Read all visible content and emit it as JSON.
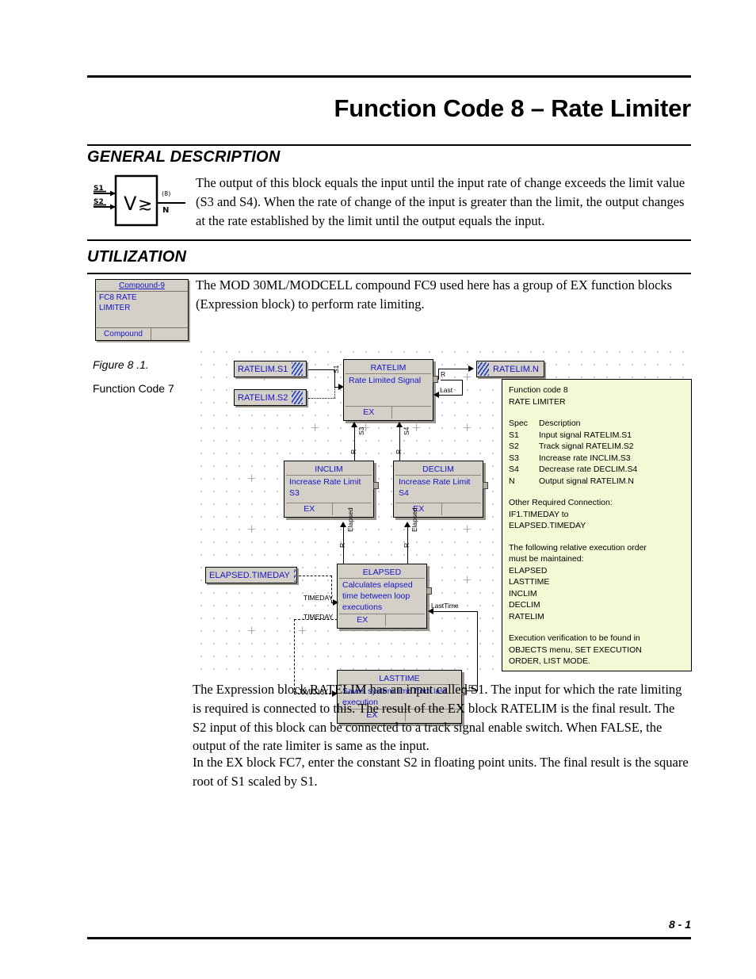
{
  "document": {
    "title": "Function Code 8 – Rate Limiter",
    "footer_page": "8 - 1"
  },
  "general_description": {
    "heading": "GENERAL DESCRIPTION",
    "symbol": {
      "input1": "S1",
      "input2": "S2",
      "glyph": "V ≯",
      "output_top": "(8)",
      "output_bottom": "N"
    },
    "text": "The output of this block equals the input until the input rate of change exceeds the limit value (S3 and S4). When the rate of change of the input is greater than the limit, the output changes at the rate established by the limit until the output equals the input."
  },
  "utilization": {
    "heading": "UTILIZATION",
    "text": "The MOD 30ML/MODCELL compound FC9 used here has a group of EX function blocks (Expression block) to perform rate limiting.",
    "compound_block": {
      "title": "Compound-9",
      "line1": "FC8    RATE",
      "line2": "LIMITER",
      "footer": "Compound"
    }
  },
  "figure": {
    "caption_line1": "Figure 8 .1.",
    "caption_line2": "Function Code 7",
    "signal_tags": [
      {
        "name": "RATELIM.S1"
      },
      {
        "name": "RATELIM.S2"
      },
      {
        "name": "RATELIM.N"
      },
      {
        "name": "ELAPSED.TIMEDAY"
      }
    ],
    "blocks": [
      {
        "id": "ratelim",
        "title": "RATELIM",
        "desc": "Rate Limited Signal",
        "type": "EX"
      },
      {
        "id": "inclim",
        "title": "INCLIM",
        "desc": "Increase Rate Limit S3",
        "type": "EX"
      },
      {
        "id": "declim",
        "title": "DECLIM",
        "desc": "Increase Rate Limit S4",
        "type": "EX"
      },
      {
        "id": "elapsed",
        "title": "ELAPSED",
        "desc": "Calculates elapsed time between loop executions",
        "type": "EX"
      },
      {
        "id": "lasttime",
        "title": "LASTTIME",
        "desc": "Saves system time from last execution",
        "type": "EX"
      }
    ],
    "connection_labels": {
      "s1": "S1",
      "r_out": "R",
      "last": "Last",
      "s3": "S3",
      "s4": "S4",
      "r_inclim": "R",
      "r_declim": "R",
      "elapsed_inclim": "Elapsed",
      "elapsed_declim": "Elapsed",
      "r_elapsed_in1": "R",
      "r_elapsed_in2": "R",
      "timeday1": "TIMEDAY",
      "timeday2": "TIMEDAY",
      "timeday3": "TIMEDAY",
      "lasttime_in": "LastTime",
      "r_lasttime": "R"
    },
    "legend": {
      "line1": "Function code 8",
      "line2": "RATE LIMITER",
      "spec_header_col1": "Spec",
      "spec_header_col2": "Description",
      "specs": [
        {
          "spec": "S1",
          "description": "Input signal RATELIM.S1"
        },
        {
          "spec": "S2",
          "description": "Track signal RATELIM.S2"
        },
        {
          "spec": "S3",
          "description": "Increase rate INCLIM.S3"
        },
        {
          "spec": "S4",
          "description": "Decrease rate DECLIM.S4"
        },
        {
          "spec": "N",
          "description": "Output signal RATELIM.N"
        }
      ],
      "other_required_title": "Other Required Connection:",
      "other_required_l1": "IF1.TIMEDAY to",
      "other_required_l2": "ELAPSED.TIMEDAY",
      "order_title_l1": "The following relative execution order",
      "order_title_l2": "must be maintained:",
      "order": [
        "ELAPSED",
        "LASTTIME",
        "INCLIM",
        "DECLIM",
        "RATELIM"
      ],
      "verify_l1": "Execution verification to be found in",
      "verify_l2": "OBJECTS menu, SET EXECUTION",
      "verify_l3": "ORDER, LIST MODE."
    }
  },
  "body": {
    "paragraph1": "The Expression block RATELIM has an input called S1. The input for which the rate limiting is required is connected to this. The result of the EX block RATELIM is the final result. The S2 input of this block can be connected to a track signal enable switch. When FALSE, the output of the rate limiter is same as the input.",
    "paragraph2": "In the EX block FC7, enter the constant S2 in floating point units. The final result is the square root of S1 scaled by S1."
  },
  "colors": {
    "legend_bg": "#f4f8d5",
    "block_face": "#d4d0c8",
    "block_text": "#1414c8",
    "ink": "#000000"
  }
}
